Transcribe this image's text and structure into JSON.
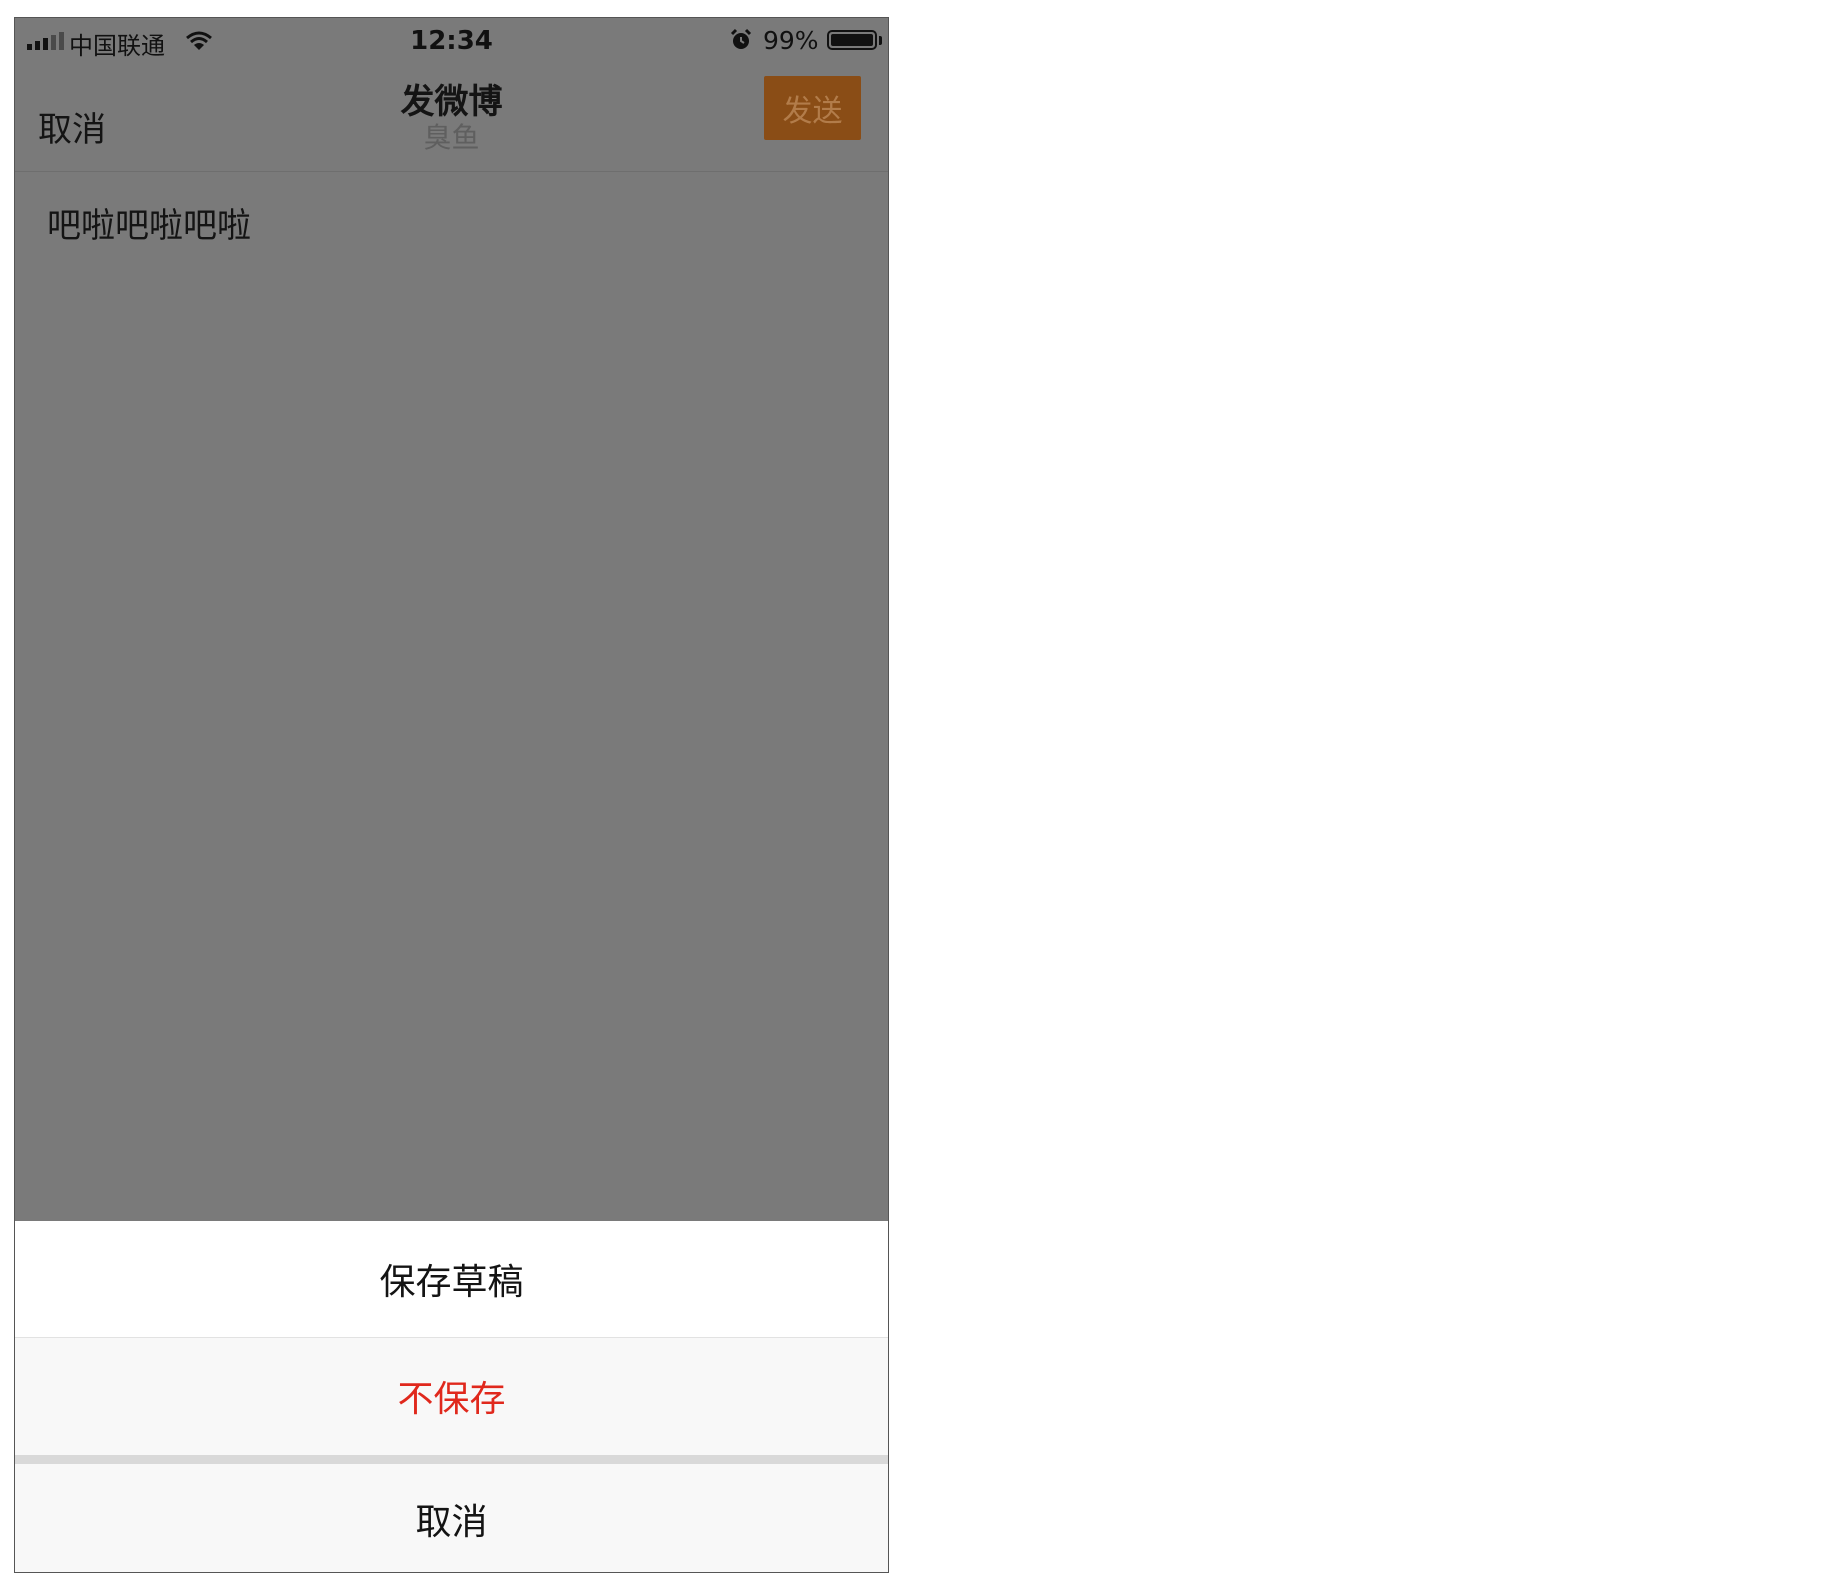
{
  "status_bar": {
    "carrier": "中国联通",
    "time": "12:34",
    "battery_percent": "99%",
    "battery_level": 0.99,
    "icons": [
      "signal-icon",
      "wifi-icon",
      "alarm-icon",
      "battery-icon"
    ]
  },
  "nav": {
    "cancel_label": "取消",
    "title": "发微博",
    "subtitle": "臭鱼",
    "send_label": "发送"
  },
  "compose": {
    "text": "吧啦吧啦吧啦"
  },
  "action_sheet": {
    "save_draft_label": "保存草稿",
    "discard_label": "不保存",
    "cancel_label": "取消"
  },
  "colors": {
    "overlay": "#7a7a7a",
    "send_button": "#8a4d16",
    "destructive": "#e0281c"
  }
}
